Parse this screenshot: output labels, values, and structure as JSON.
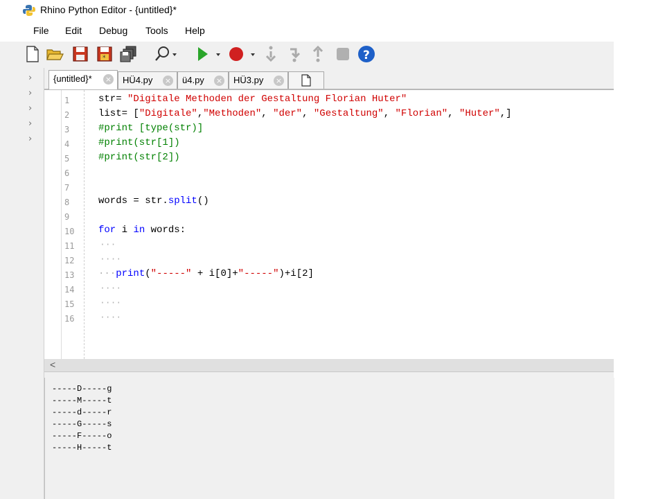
{
  "window": {
    "title": "Rhino Python Editor - {untitled}*"
  },
  "menu": [
    "File",
    "Edit",
    "Debug",
    "Tools",
    "Help"
  ],
  "toolbar": {
    "buttons": [
      "new-file-icon",
      "open-folder-icon",
      "save-icon",
      "save-as-icon",
      "save-all-icon",
      "find-icon",
      "run-icon",
      "breakpoint-icon",
      "step-into-icon",
      "step-over-icon",
      "step-out-icon",
      "stop-icon",
      "help-icon"
    ],
    "colors": {
      "run": "#2aa52a",
      "breakpoint": "#d02020",
      "help": "#1e60c8"
    }
  },
  "tabs": [
    {
      "label": "{untitled}*",
      "active": true
    },
    {
      "label": "HÜ4.py",
      "active": false
    },
    {
      "label": "ü4.py",
      "active": false
    },
    {
      "label": "HÜ3.py",
      "active": false
    }
  ],
  "new_tab_icon": "new-document-icon",
  "editor": {
    "line_numbers": [
      "1",
      "2",
      "3",
      "4",
      "5",
      "6",
      "7",
      "8",
      "9",
      "10",
      "11",
      "12",
      "13",
      "14",
      "15",
      "16"
    ],
    "line1": {
      "a": "str= ",
      "b": "\"Digitale Methoden der Gestaltung Florian Huter\""
    },
    "line2": {
      "a": "list= [",
      "s1": "\"Digitale\"",
      "c1": ",",
      "s2": "\"Methoden\"",
      "c2": ", ",
      "s3": "\"der\"",
      "c3": ", ",
      "s4": "\"Gestaltung\"",
      "c4": ", ",
      "s5": "\"Florian\"",
      "c5": ", ",
      "s6": "\"Huter\"",
      "c6": ",]"
    },
    "line3": "#print [type(str)]",
    "line4": "#print(str[1])",
    "line5": "#print(str[2])",
    "line8": {
      "a": "words = str.",
      "b": "split",
      "c": "()"
    },
    "line10": {
      "kw1": "for",
      "a": " i ",
      "kw2": "in",
      "b": " words:"
    },
    "line13": {
      "dots": "···",
      "kw": "print",
      "a": "(",
      "s1": "\"-----\"",
      "b": " + i[0]+",
      "s2": "\"-----\"",
      "c": ")+i[2]"
    },
    "indent_dots": "···",
    "indent_dots_4": "····"
  },
  "output": [
    "-----D-----g",
    "-----M-----t",
    "-----d-----r",
    "-----G-----s",
    "-----F-----o",
    "-----H-----t"
  ]
}
